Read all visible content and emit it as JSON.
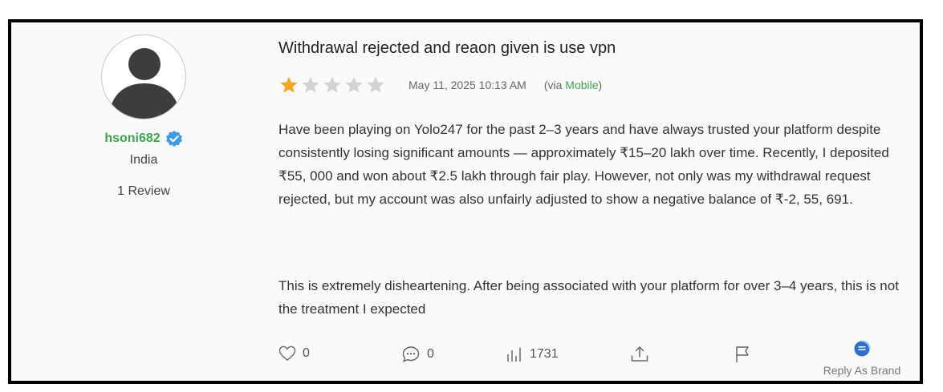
{
  "reviewer": {
    "username": "hsoni682",
    "country": "India",
    "review_count": "1 Review",
    "verified_icon": "verified-check-icon",
    "avatar_icon": "default-user-avatar-icon"
  },
  "review": {
    "title": "Withdrawal rejected and reaon given is use vpn",
    "rating": 1,
    "rating_max": 5,
    "date": "May 11, 2025 10:13 AM",
    "via_prefix": "(via ",
    "via_source": "Mobile",
    "via_suffix": ")",
    "paragraph1": "Have been playing on Yolo247 for the past 2–3 years and have always trusted your platform despite consistently losing significant amounts — approximately ₹15–20 lakh over time. Recently, I deposited ₹55, 000 and won about ₹2.5 lakh through fair play. However, not only was my withdrawal request rejected, but my account was also unfairly adjusted to show a negative balance of ₹-2, 55, 691.",
    "paragraph2": "This is extremely disheartening. After being associated with your platform for over 3–4 years, this is not the treatment I expected"
  },
  "actions": {
    "likes": "0",
    "comments": "0",
    "views": "1731",
    "reply_label": "Reply As Brand"
  },
  "colors": {
    "star_filled": "#f5a623",
    "star_empty": "#d3d3d3",
    "accent_green": "#3aa64c",
    "verified_blue": "#3b9bea",
    "reply_blue": "#2d6fd1"
  }
}
